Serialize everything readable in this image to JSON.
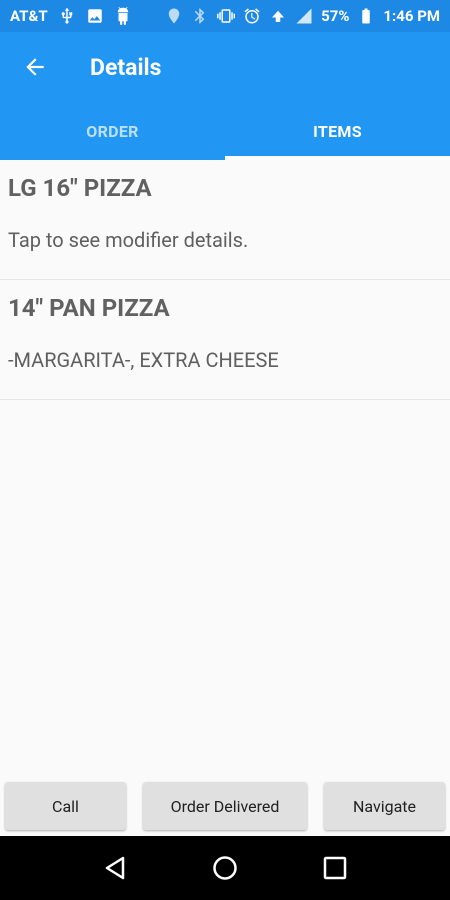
{
  "status_bar": {
    "carrier": "AT&T",
    "battery": "57%",
    "time": "1:46 PM",
    "icons": [
      "usb-icon",
      "image-icon",
      "android-icon",
      "location-icon",
      "bluetooth-icon",
      "vibrate-icon",
      "alarm-icon",
      "data-icon",
      "signal-icon",
      "battery-icon"
    ]
  },
  "app_bar": {
    "title": "Details",
    "back_icon": "arrow-left-icon"
  },
  "tabs": [
    {
      "label": "ORDER",
      "active": false
    },
    {
      "label": "ITEMS",
      "active": true
    }
  ],
  "items": [
    {
      "title": "LG 16\" PIZZA",
      "description": "Tap to see modifier details."
    },
    {
      "title": "14\" PAN PIZZA",
      "description": "-MARGARITA-, EXTRA CHEESE"
    }
  ],
  "buttons": {
    "call": "Call",
    "order_delivered": "Order Delivered",
    "navigate": "Navigate"
  },
  "nav_bar": {
    "icons": [
      "back-triangle-icon",
      "home-circle-icon",
      "recents-square-icon"
    ]
  },
  "colors": {
    "primary": "#2196f3",
    "status_bar": "#1e88e5",
    "background": "#fafafa",
    "button": "#e0e0e0"
  }
}
